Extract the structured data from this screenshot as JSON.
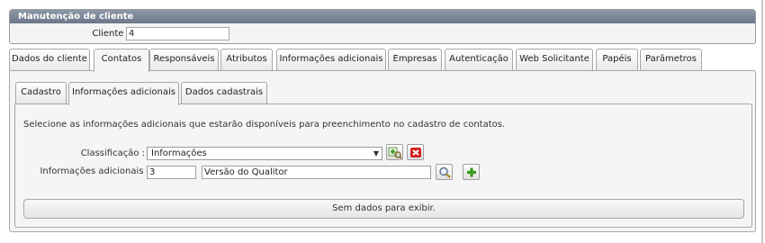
{
  "header": {
    "title": "Manutenção de cliente"
  },
  "client": {
    "label": "Cliente :",
    "value": "4"
  },
  "tabs": [
    {
      "label": "Dados do cliente"
    },
    {
      "label": "Contatos"
    },
    {
      "label": "Responsáveis"
    },
    {
      "label": "Atributos"
    },
    {
      "label": "Informações adicionais"
    },
    {
      "label": "Empresas"
    },
    {
      "label": "Autenticação"
    },
    {
      "label": "Web Solicitante"
    },
    {
      "label": "Papéis"
    },
    {
      "label": "Parâmetros"
    }
  ],
  "active_tab": "Contatos",
  "subtabs": [
    {
      "label": "Cadastro"
    },
    {
      "label": "Informações adicionais"
    },
    {
      "label": "Dados cadastrais"
    }
  ],
  "active_subtab": "Informações adicionais",
  "form": {
    "description": "Selecione as informações adicionais que estarão disponíveis para preenchimento no cadastro de contatos.",
    "classification_label": "Classificação :",
    "classification_value": "Informações",
    "info_label": "Informações adicionais :",
    "info_code": "3",
    "info_name": "Versão do Qualitor"
  },
  "grid": {
    "empty_text": "Sem dados para exibir."
  },
  "icons": {
    "add_classification": "add-classification-icon",
    "remove": "delete-icon",
    "search": "search-icon",
    "add": "plus-icon"
  },
  "colors": {
    "header_bg": "#7a8496",
    "panel_bg": "#f5f5f5",
    "plus_green": "#3a9a1e",
    "delete_red": "#d32020"
  }
}
